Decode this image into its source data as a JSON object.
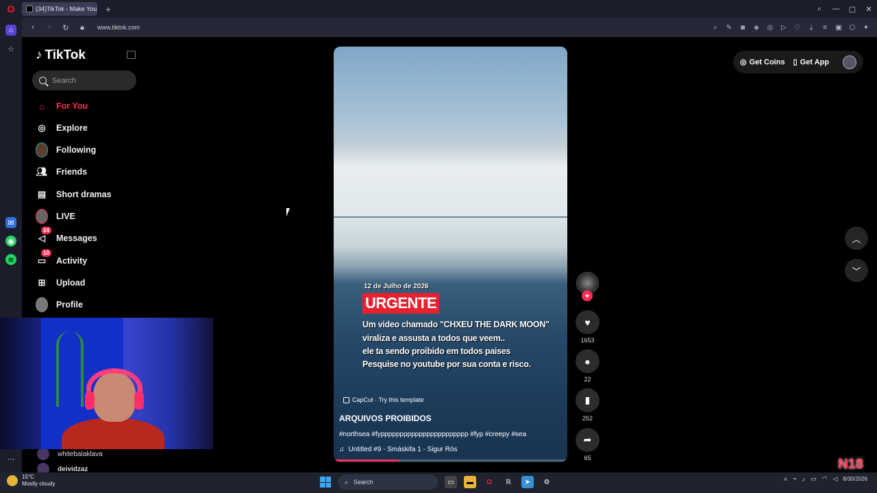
{
  "browser": {
    "tab_title": "(34)TikTok - Make You",
    "url": "www.tiktok.com"
  },
  "tiktok": {
    "logo_text": "TikTok",
    "search_placeholder": "Search",
    "nav": [
      {
        "label": "For You",
        "active": true
      },
      {
        "label": "Explore"
      },
      {
        "label": "Following"
      },
      {
        "label": "Friends"
      },
      {
        "label": "Short dramas"
      },
      {
        "label": "LIVE"
      },
      {
        "label": "Messages",
        "badge": "24"
      },
      {
        "label": "Activity",
        "badge": "10"
      },
      {
        "label": "Upload"
      },
      {
        "label": "Profile"
      }
    ],
    "following_accounts": [
      "whitebalaklava",
      "deividzaz"
    ],
    "header": {
      "get_coins": "Get Coins",
      "get_app": "Get App"
    }
  },
  "video": {
    "overlay_date": "12 de Julho de 2026",
    "overlay_badge": "URGENTE",
    "overlay_lines": [
      "Um video chamado \"CHXEU THE DARK MOON\"",
      "viraliza e assusta a todos que veem..",
      "ele ta sendo proibido em todos paises",
      "Pesquise no youtube por sua conta e risco."
    ],
    "capcut": "CapCut · Try this template",
    "title": "ARQUIVOS PROIBIDOS",
    "tags": "#northsea  #fyppppppppppppppppppppppp  #fyp  #creepy  #sea",
    "sound": "Untitled #9 - Smáskifa 1 - Sigur Rós",
    "progress": 0.28
  },
  "actions": {
    "likes": "1653",
    "comments": "22",
    "saves": "252",
    "shares": "65"
  },
  "taskbar": {
    "temperature": "15°C",
    "weather": "Mostly cloudy",
    "search": "Search",
    "date": "8/30/2026"
  },
  "colors": {
    "accent": "#fe2c55",
    "urgent_red": "#e8212e"
  }
}
